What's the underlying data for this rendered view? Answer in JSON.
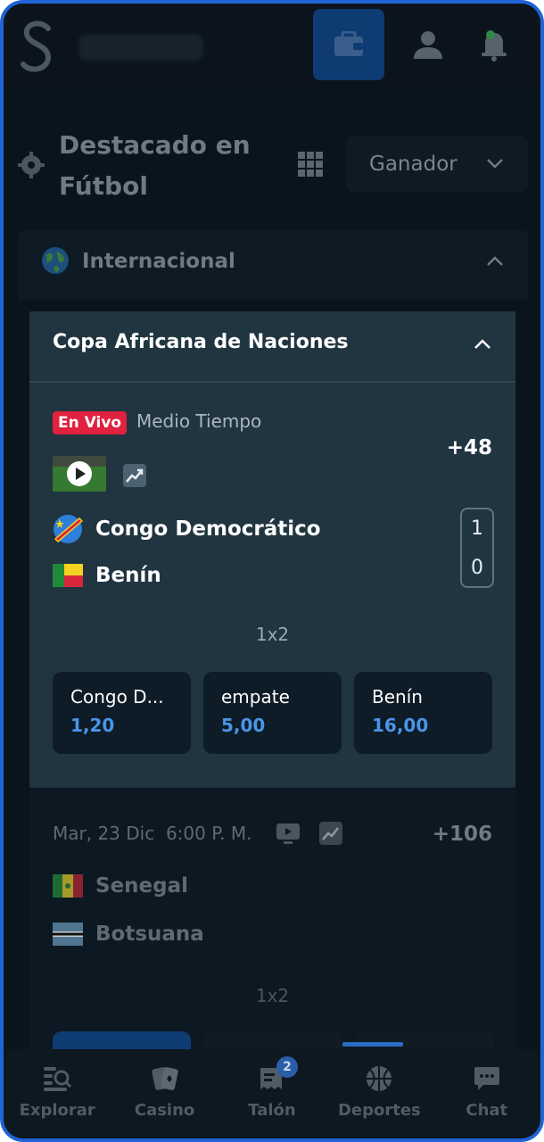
{
  "header": {
    "logo_icon": "brand-s-logo",
    "wallet_icon": "wallet-icon",
    "profile_icon": "user-icon",
    "notifications_icon": "bell-icon"
  },
  "section": {
    "title": "Destacado en Fútbol",
    "market_selector": "Ganador"
  },
  "region": {
    "label": "Internacional"
  },
  "league": {
    "title": "Copa Africana de Naciones"
  },
  "live_event": {
    "live_badge": "En Vivo",
    "status": "Medio Tiempo",
    "more_markets": "+48",
    "home_team": "Congo Democrático",
    "away_team": "Benín",
    "home_score": "1",
    "away_score": "0",
    "market_label": "1x2",
    "odds": [
      {
        "label": "Congo D...",
        "value": "1,20"
      },
      {
        "label": "empate",
        "value": "5,00"
      },
      {
        "label": "Benín",
        "value": "16,00"
      }
    ]
  },
  "next_event": {
    "date": "Mar, 23 Dic",
    "time": "6:00 P. M.",
    "more_markets": "+106",
    "home_team": "Senegal",
    "away_team": "Botsuana",
    "market_label": "1x2"
  },
  "bottom_nav": {
    "items": [
      {
        "label": "Explorar",
        "icon": "explore-icon"
      },
      {
        "label": "Casino",
        "icon": "cards-icon"
      },
      {
        "label": "Talón",
        "icon": "betslip-icon",
        "badge": "2"
      },
      {
        "label": "Deportes",
        "icon": "basketball-icon"
      },
      {
        "label": "Chat",
        "icon": "chat-icon"
      }
    ]
  },
  "colors": {
    "accent_blue": "#1f63d6",
    "live_red": "#e0213f",
    "odds_blue": "#4a95ea"
  }
}
